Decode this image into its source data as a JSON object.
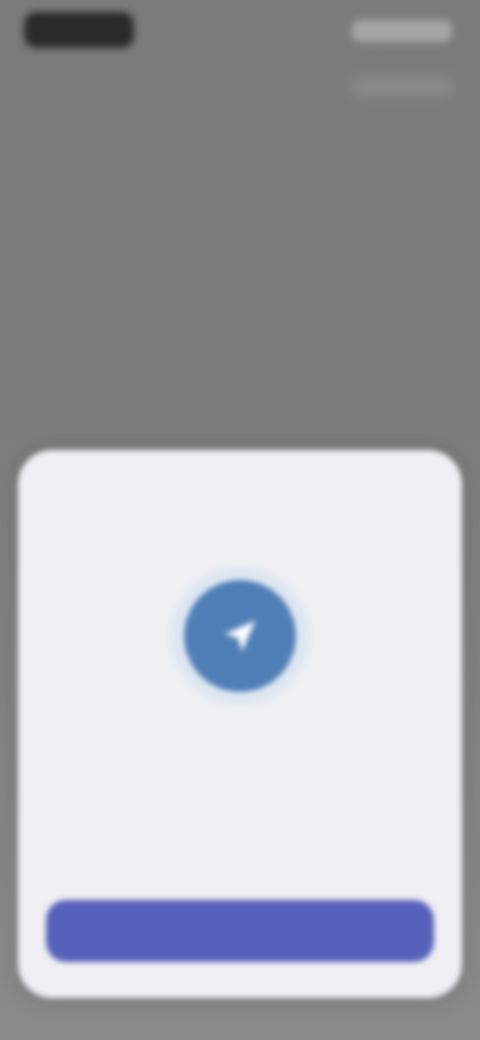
{
  "status_bar": {
    "time": "",
    "icons": ""
  },
  "sheet": {
    "title": "",
    "icon": "location-arrow-icon",
    "body": "",
    "primary_button_label": ""
  },
  "colors": {
    "background": "#7c7c7c",
    "sheet": "#efeff4",
    "icon_circle": "#4f7eb7",
    "button": "#5661bb"
  }
}
